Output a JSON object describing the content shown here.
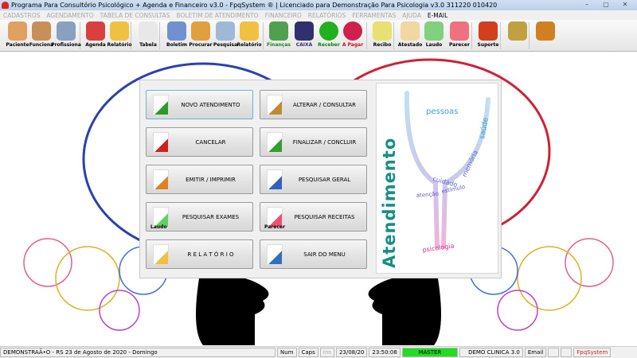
{
  "window": {
    "title": "Programa Para Consultório Psicológico + Agenda e Financeiro v3.0 - FpqSystem ® | Licenciado para  Demonstração Para Psicologia v3.0 311220 010420",
    "minimize": "–",
    "maximize": "▢",
    "close": "✕"
  },
  "menu": [
    "CADASTROS",
    "AGENDAMENTO",
    "TABELA DE CONSULTAS",
    "BOLETIM DE ATENDIMENTO",
    "FINANCEIRO",
    "RELATÓRIOS",
    "FERRAMENTAS",
    "AJUDA"
  ],
  "menu_email": "E-MAIL",
  "toolbar": [
    {
      "label": "Paciente",
      "icon": "patient-icon",
      "color": "#e0a060"
    },
    {
      "label": "Funciona",
      "icon": "employee-icon",
      "color": "#c89058"
    },
    {
      "label": "Profissiona",
      "icon": "doctor-icon",
      "color": "#8aa0c0"
    },
    {
      "label": "Agenda",
      "icon": "calendar-icon",
      "color": "#d84040"
    },
    {
      "label": "Relatório",
      "icon": "printer-icon",
      "color": "#f0c040"
    },
    {
      "label": "Tabela",
      "icon": "table-doc-icon",
      "color": "#e8e8e8"
    },
    {
      "label": "Boletim",
      "icon": "bulletin-icon",
      "color": "#7090d0"
    },
    {
      "label": "Procurar",
      "icon": "folder-icon",
      "color": "#e0a040"
    },
    {
      "label": "Pesquisa",
      "icon": "search-doc-icon",
      "color": "#a0b8d8"
    },
    {
      "label": "Relatório",
      "icon": "printer-icon",
      "color": "#f0c040"
    },
    {
      "label": "Finanças",
      "icon": "finance-icon",
      "color": "#50a050"
    },
    {
      "label": "CAIXA",
      "icon": "cashbook-icon",
      "color": "#303070"
    },
    {
      "label": "Receber",
      "icon": "receive-dollar-icon",
      "color": "#20b020"
    },
    {
      "label": "A Pagar",
      "icon": "pay-dollar-icon",
      "color": "#d02050"
    },
    {
      "label": "Recibo",
      "icon": "receipt-icon",
      "color": "#e8e070"
    },
    {
      "label": "Atestado",
      "icon": "certificate-icon",
      "color": "#f0d8a0"
    },
    {
      "label": "Laudo",
      "icon": "report-icon",
      "color": "#80d080"
    },
    {
      "label": "Parecer",
      "icon": "opinion-icon",
      "color": "#f07080"
    },
    {
      "label": "Suporte",
      "icon": "support-icon",
      "color": "#d04020"
    },
    {
      "label": "",
      "icon": "coin-icon",
      "color": "#c0a040"
    },
    {
      "label": "",
      "icon": "exit-door-icon",
      "color": "#d08020"
    }
  ],
  "buttons": [
    {
      "label": "NOVO ATENDIMENTO",
      "icon": "new-doc-plus-icon",
      "sub": ""
    },
    {
      "label": "ALTERAR  /  CONSULTAR",
      "icon": "pencil-doc-icon",
      "sub": ""
    },
    {
      "label": "CANCELAR",
      "icon": "cancel-doc-icon",
      "sub": ""
    },
    {
      "label": "FINALIZAR  /  CONCLUIR",
      "icon": "check-doc-icon",
      "sub": ""
    },
    {
      "label": "EMITIR  /  IMPRIMIR",
      "icon": "emit-person-icon",
      "sub": ""
    },
    {
      "label": "PESQUISAR GERAL",
      "icon": "search-general-icon",
      "sub": ""
    },
    {
      "label": "PESQUISAR EXAMES",
      "icon": "laudo-icon",
      "sub": "Laudo"
    },
    {
      "label": "PESQUISAR RECEITAS",
      "icon": "parecer-icon",
      "sub": "Parecer"
    },
    {
      "label": "R E L A T Ó R I O",
      "icon": "printer-icon",
      "sub": ""
    },
    {
      "label": "SAIR DO MENU",
      "icon": "exit-menu-icon",
      "sub": ""
    }
  ],
  "side_image": {
    "title": "Atendimento",
    "words": [
      "pessoas",
      "saúde",
      "memória",
      "psicologia",
      "cuidado",
      "estímulo",
      "atenção"
    ]
  },
  "status": {
    "left": "DEMONSTRAÃ•O - RS 23 de Agosto de 2020 - Domingo",
    "num": "Num",
    "caps": "Caps",
    "ins": "Ins",
    "date": "23/08/20",
    "time": "23:50:08",
    "user": "MASTER",
    "company": "DEMO CLINICA 3.0",
    "email": "Email",
    "brand": "FpqSystem"
  },
  "colors": {
    "accent": "#168f85",
    "master": "#22dd22",
    "brand": "#cc2222"
  }
}
